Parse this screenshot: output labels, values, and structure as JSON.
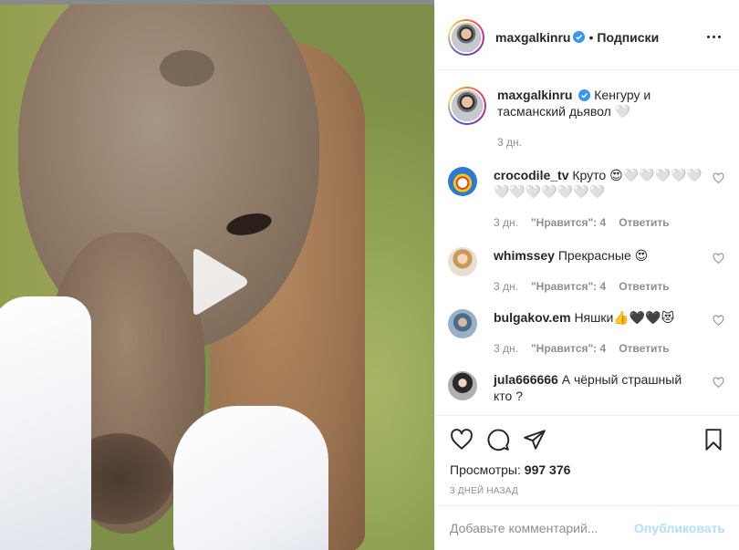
{
  "post": {
    "author": "maxgalkinru",
    "follow_label": "Подписки",
    "caption_text": "Кенгуру и тасманский дьявол 🤍",
    "caption_time": "3 дн."
  },
  "comments": [
    {
      "username": "crocodile_tv",
      "text": "Круто 😍🤍🤍🤍🤍🤍🤍🤍🤍🤍🤍🤍🤍",
      "time": "3 дн.",
      "likes": "\"Нравится\": 4",
      "reply": "Ответить"
    },
    {
      "username": "whimssey",
      "text": "Прекрасные 😍",
      "time": "3 дн.",
      "likes": "\"Нравится\": 4",
      "reply": "Ответить"
    },
    {
      "username": "bulgakov.em",
      "text": "Няшки👍🖤🖤😻",
      "time": "3 дн.",
      "likes": "\"Нравится\": 4",
      "reply": "Ответить"
    },
    {
      "username": "jula666666",
      "text": "А чёрный страшный кто ?"
    }
  ],
  "stats": {
    "views_label": "Просмотры:",
    "views_count": "997 376",
    "ago": "3 ДНЕЙ НАЗАД"
  },
  "composer": {
    "placeholder": "Добавьте комментарий...",
    "publish_label": "Опубликовать"
  },
  "colors": {
    "verified": "#3897f0",
    "publish_disabled": "#b2dffc"
  }
}
